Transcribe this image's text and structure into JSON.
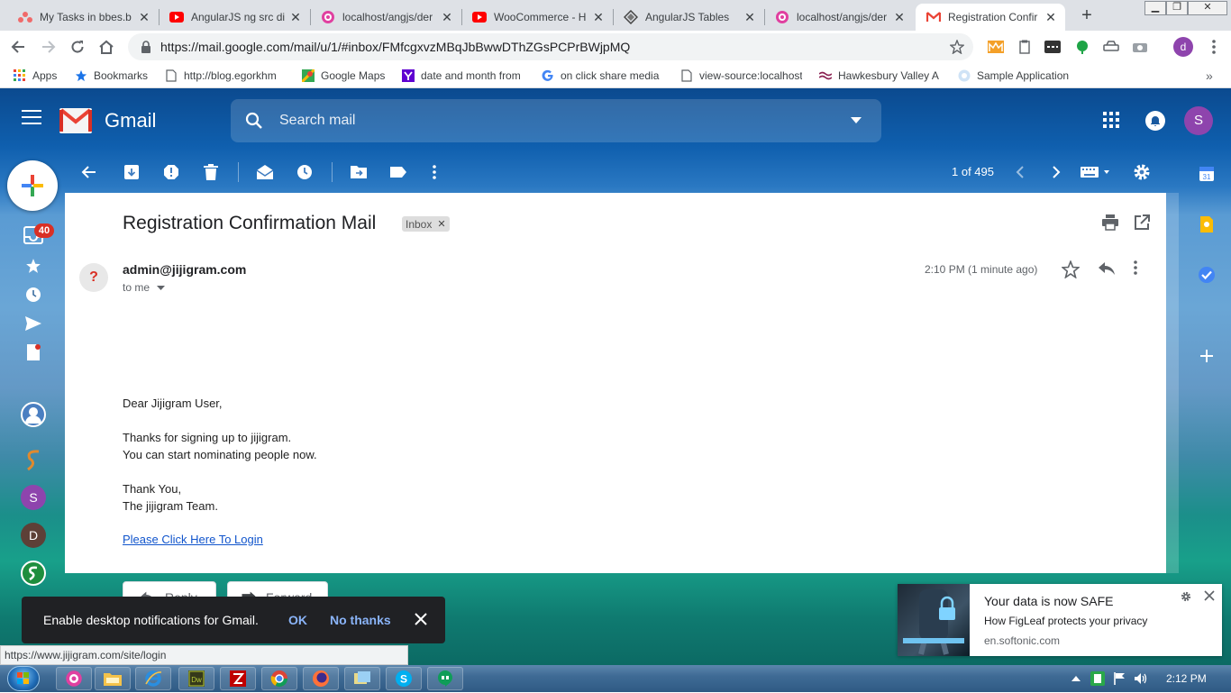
{
  "browser": {
    "tabs": [
      {
        "title": "My Tasks in bbes.b",
        "icon": "asana-icon"
      },
      {
        "title": "AngularJS ng src di",
        "icon": "youtube-icon"
      },
      {
        "title": "localhost/angjs/der",
        "icon": "webstorm-icon"
      },
      {
        "title": "WooCommerce - H",
        "icon": "youtube-icon"
      },
      {
        "title": "AngularJS Tables",
        "icon": "angular-icon"
      },
      {
        "title": "localhost/angjs/der",
        "icon": "webstorm-icon"
      },
      {
        "title": "Registration Confir",
        "icon": "gmail-icon",
        "active": true
      }
    ],
    "url": "https://mail.google.com/mail/u/1/#inbox/FMfcgxvzMBqJbBwwDThZGsPCPrBWjpMQ",
    "profile_initial": "d",
    "bookmarks": [
      {
        "label": "Apps",
        "icon": "apps-grid-icon"
      },
      {
        "label": "Bookmarks",
        "icon": "star-icon"
      },
      {
        "label": "http://blog.egorkhm",
        "icon": "page-icon"
      },
      {
        "label": "Google Maps",
        "icon": "maps-icon"
      },
      {
        "label": "date and month from",
        "icon": "yahoo-icon"
      },
      {
        "label": "on click share media",
        "icon": "google-icon"
      },
      {
        "label": "view-source:localhost",
        "icon": "page-icon"
      },
      {
        "label": "Hawkesbury Valley A",
        "icon": "site-icon"
      },
      {
        "label": "Sample Application",
        "icon": "site-icon"
      }
    ],
    "status_url": "https://www.jijigram.com/site/login"
  },
  "gmail": {
    "logo_text": "Gmail",
    "search_placeholder": "Search mail",
    "account_initial": "S",
    "inbox_badge": "40",
    "rail_avatars": [
      "S",
      "D"
    ],
    "page_count": "1 of 495",
    "message": {
      "subject": "Registration Confirmation Mail",
      "label": "Inbox",
      "sender": "admin@jijigram.com",
      "to": "to me",
      "time": "2:10 PM (1 minute ago)",
      "body": [
        "Dear Jijigram User,",
        "Thanks for signing up to jijigram.",
        "You can start nominating people now.",
        "Thank You,",
        "The jijigram Team."
      ],
      "link_text": "Please Click Here To Login",
      "reply_label": "Reply",
      "forward_label": "Forward"
    },
    "snackbar": {
      "message": "Enable desktop notifications for Gmail.",
      "ok": "OK",
      "no": "No thanks"
    }
  },
  "ad": {
    "title": "Your data is now SAFE",
    "subtitle": "How FigLeaf protects your privacy",
    "source": "en.softonic.com"
  },
  "taskbar": {
    "clock": "2:12 PM"
  },
  "colors": {
    "gmail_red": "#ea4335",
    "link": "#1155cc",
    "snack_action": "#8ab4f8"
  }
}
